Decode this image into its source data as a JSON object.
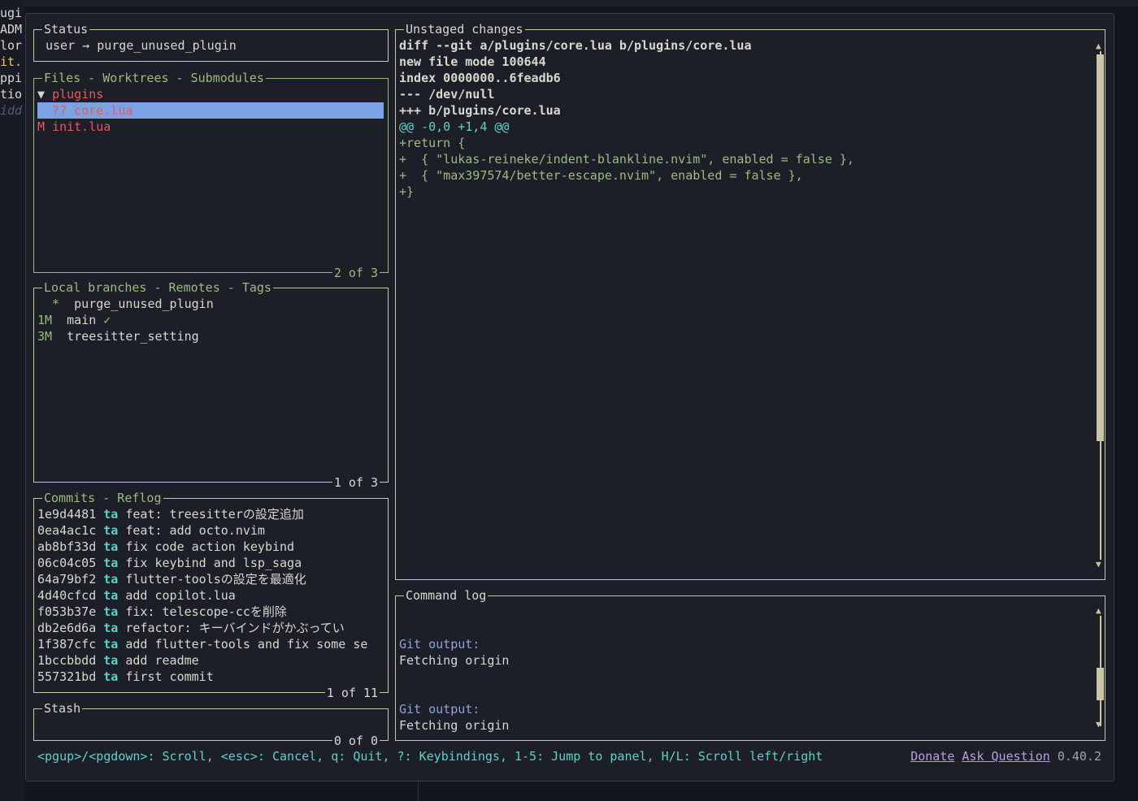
{
  "gutter": [
    "ugi",
    "ADM",
    "lor",
    "it.",
    "ppi",
    "tio",
    "idd"
  ],
  "status_panel": {
    "title": "Status",
    "text": "user → purge_unused_plugin"
  },
  "files_panel": {
    "title": "Files - Worktrees - Submodules",
    "footer": "2 of 3",
    "rows": [
      {
        "prefix": "▼ ",
        "name": "plugins",
        "selected": false
      },
      {
        "prefix": "  ?? ",
        "name": "core.lua",
        "selected": true
      },
      {
        "prefix": "M ",
        "name": "init.lua",
        "selected": false
      }
    ]
  },
  "branches_panel": {
    "title": "Local branches - Remotes - Tags",
    "footer": "1 of 3",
    "rows": [
      {
        "age": "  *",
        "name": "purge_unused_plugin",
        "check": ""
      },
      {
        "age": "1M",
        "name": "main",
        "check": "✓"
      },
      {
        "age": "3M",
        "name": "treesitter_setting",
        "check": ""
      }
    ]
  },
  "commits_panel": {
    "title": "Commits - Reflog",
    "footer": "1 of 11",
    "rows": [
      {
        "hash": "1e9d4481",
        "author": "ta",
        "msg": "feat: treesitterの設定追加"
      },
      {
        "hash": "0ea4ac1c",
        "author": "ta",
        "msg": "feat: add octo.nvim"
      },
      {
        "hash": "ab8bf33d",
        "author": "ta",
        "msg": "fix code action keybind"
      },
      {
        "hash": "06c04c05",
        "author": "ta",
        "msg": "fix keybind and lsp_saga"
      },
      {
        "hash": "64a79bf2",
        "author": "ta",
        "msg": "flutter-toolsの設定を最適化"
      },
      {
        "hash": "4d40cfcd",
        "author": "ta",
        "msg": "add copilot.lua"
      },
      {
        "hash": "f053b37e",
        "author": "ta",
        "msg": "fix: telescope-ccを削除"
      },
      {
        "hash": "db2e6d6a",
        "author": "ta",
        "msg": "refactor: キーバインドがかぶってい"
      },
      {
        "hash": "1f387cfc",
        "author": "ta",
        "msg": "add flutter-tools and fix some se"
      },
      {
        "hash": "1bccbbdd",
        "author": "ta",
        "msg": "add readme"
      },
      {
        "hash": "557321bd",
        "author": "ta",
        "msg": "first commit"
      }
    ]
  },
  "stash_panel": {
    "title": "Stash",
    "footer": "0 of 0"
  },
  "diff_panel": {
    "title": "Unstaged changes",
    "lines": [
      {
        "text": "diff --git a/plugins/core.lua b/plugins/core.lua",
        "kind": "header"
      },
      {
        "text": "new file mode 100644",
        "kind": "header"
      },
      {
        "text": "index 0000000..6feadb6",
        "kind": "header"
      },
      {
        "text": "--- /dev/null",
        "kind": "header"
      },
      {
        "text": "+++ b/plugins/core.lua",
        "kind": "header"
      },
      {
        "text": "@@ -0,0 +1,4 @@",
        "kind": "hunk"
      },
      {
        "text": "+return {",
        "kind": "add"
      },
      {
        "text": "+  { \"lukas-reineke/indent-blankline.nvim\", enabled = false },",
        "kind": "add"
      },
      {
        "text": "+  { \"max397574/better-escape.nvim\", enabled = false },",
        "kind": "add"
      },
      {
        "text": "+}",
        "kind": "add"
      }
    ]
  },
  "command_log": {
    "title": "Command log",
    "entries": [
      {
        "label": "Git output:",
        "text": "Fetching origin"
      },
      {
        "label": "Git output:",
        "text": "Fetching origin"
      }
    ]
  },
  "footer": {
    "keybindings": "<pgup>/<pgdown>: Scroll, <esc>: Cancel, q: Quit, ?: Keybindings, 1-5: Jump to panel, H/L: Scroll left/right",
    "donate": "Donate",
    "ask": "Ask Question",
    "version": "0.40.2"
  },
  "colors": {
    "border": "#c9c7a6",
    "active_border": "#9cbc7c",
    "selection": "#7aa2e4",
    "hash": "#d8d8cf",
    "author": "#5ed3c5",
    "keybinding_text": "#5ed3c5",
    "link": "#b6a1e0"
  }
}
